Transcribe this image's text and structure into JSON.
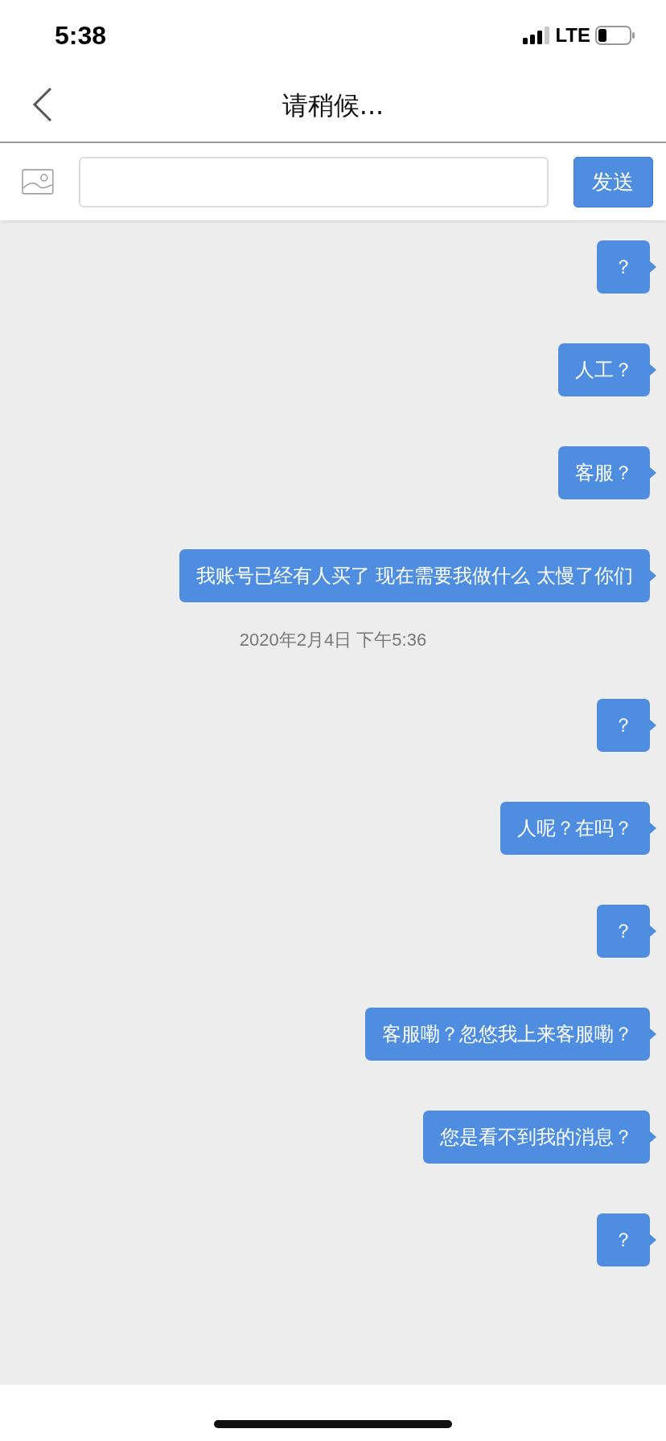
{
  "status_bar": {
    "time": "5:38",
    "network": "LTE"
  },
  "nav": {
    "title": "请稍候..."
  },
  "composer": {
    "send_label": "发送"
  },
  "messages": [
    {
      "kind": "message",
      "text": "？"
    },
    {
      "kind": "message",
      "text": "人工？"
    },
    {
      "kind": "message",
      "text": "客服？"
    },
    {
      "kind": "message",
      "text": "我账号已经有人买了 现在需要我做什么 太慢了你们"
    },
    {
      "kind": "timestamp",
      "text": "2020年2月4日 下午5:36"
    },
    {
      "kind": "message",
      "text": "？"
    },
    {
      "kind": "message",
      "text": "人呢？在吗？"
    },
    {
      "kind": "message",
      "text": "？"
    },
    {
      "kind": "message",
      "text": "客服嘞？忽悠我上来客服嘞？"
    },
    {
      "kind": "message",
      "text": "您是看不到我的消息？"
    },
    {
      "kind": "message",
      "text": "？"
    }
  ]
}
